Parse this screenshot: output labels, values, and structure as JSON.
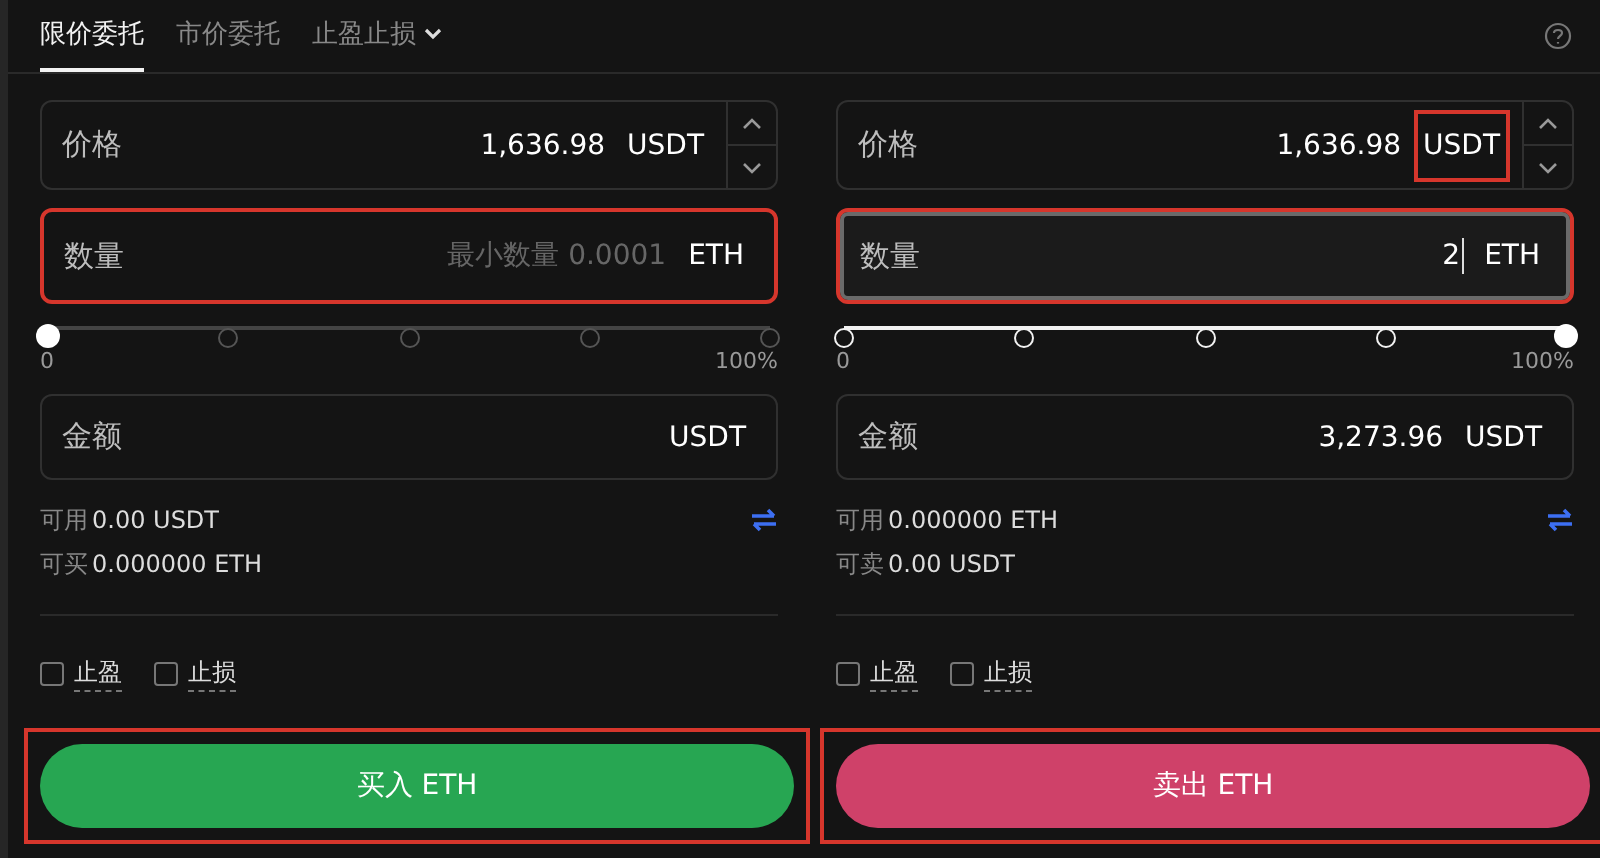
{
  "tabs": [
    {
      "label": "限价委托",
      "selected": true,
      "dropdown": false
    },
    {
      "label": "市价委托",
      "selected": false,
      "dropdown": false
    },
    {
      "label": "止盈止损",
      "selected": false,
      "dropdown": true
    }
  ],
  "panels": [
    {
      "price": {
        "label": "价格",
        "value": "1,636.98",
        "unit": "USDT",
        "unit_highlighted": false
      },
      "quantity": {
        "label": "数量",
        "placeholder": "最小数量 0.0001",
        "unit": "ETH",
        "highlighted": true,
        "focused": false
      },
      "slider": {
        "level": 0,
        "min_label": "0",
        "max_label": "100%"
      },
      "amount": {
        "label": "金额",
        "unit": "USDT"
      },
      "balances": [
        {
          "label": "可用",
          "value": "0.00 USDT"
        },
        {
          "label": "可买",
          "value": "0.000000 ETH"
        }
      ],
      "options": [
        {
          "label": "止盈",
          "checked": false
        },
        {
          "label": "止损",
          "checked": false
        }
      ],
      "action": {
        "label": "买入 ETH",
        "kind": "buy",
        "highlighted": true
      }
    },
    {
      "price": {
        "label": "价格",
        "value": "1,636.98",
        "unit": "USDT",
        "unit_highlighted": true
      },
      "quantity": {
        "label": "数量",
        "value": "2",
        "unit": "ETH",
        "highlighted": true,
        "focused": true
      },
      "slider": {
        "level": 1,
        "min_label": "0",
        "max_label": "100%"
      },
      "amount": {
        "label": "金额",
        "value": "3,273.96",
        "unit": "USDT"
      },
      "balances": [
        {
          "label": "可用",
          "value": "0.000000 ETH"
        },
        {
          "label": "可卖",
          "value": "0.00 USDT"
        }
      ],
      "options": [
        {
          "label": "止盈",
          "checked": false
        },
        {
          "label": "止损",
          "checked": false
        }
      ],
      "action": {
        "label": "卖出 ETH",
        "kind": "sell",
        "highlighted": true
      }
    }
  ]
}
